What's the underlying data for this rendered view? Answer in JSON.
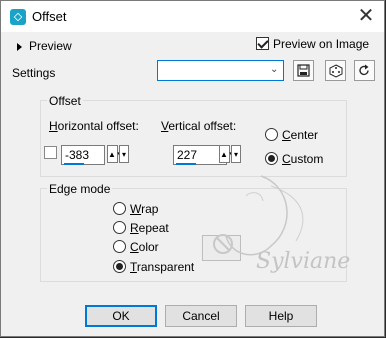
{
  "window": {
    "title": "Offset",
    "close_glyph": "✕",
    "icon": "offset-app-icon"
  },
  "preview": {
    "label": "Preview",
    "on_image_label": "Preview on Image",
    "on_image_checked": true
  },
  "settings": {
    "label": "Settings",
    "value": "",
    "icons": [
      "save-preset-icon",
      "randomize-icon",
      "reset-icon"
    ]
  },
  "offset": {
    "group_title": "Offset",
    "horizontal_label": "Horizontal offset:",
    "horizontal_value": "-383",
    "vertical_label": "Vertical offset:",
    "vertical_value": "227",
    "center_label": "Center",
    "custom_label": "Custom",
    "mode": "Custom"
  },
  "edge_mode": {
    "group_title": "Edge mode",
    "options": [
      "Wrap",
      "Repeat",
      "Color",
      "Transparent"
    ],
    "selected": "Transparent"
  },
  "watermark": {
    "text": "Sylviane"
  },
  "buttons": {
    "ok": "OK",
    "cancel": "Cancel",
    "help": "Help"
  }
}
